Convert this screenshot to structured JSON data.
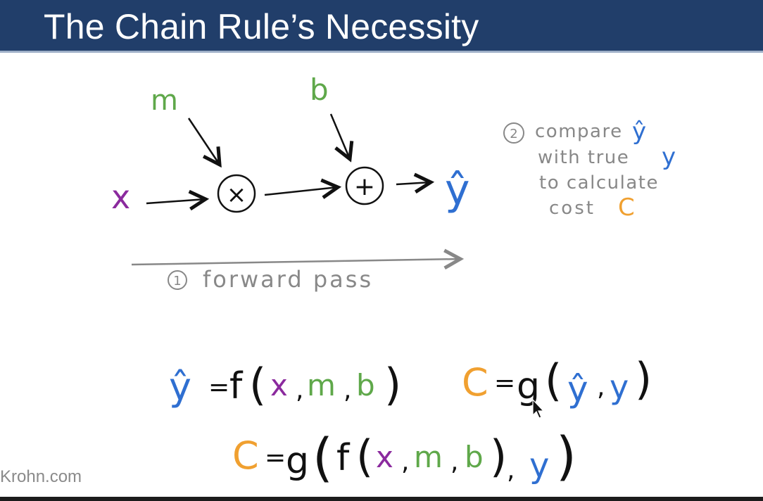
{
  "slide": {
    "title": "The Chain Rule’s Necessity",
    "watermark": "Krohn.com"
  },
  "graph": {
    "input_x": "x",
    "param_m": "m",
    "param_b": "b",
    "op_multiply": "×",
    "op_add": "+",
    "output_yhat": "ŷ"
  },
  "forward_pass": {
    "step_number": "1",
    "label": "forward pass"
  },
  "compare_note": {
    "step_number": "2",
    "line1_text": "compare",
    "line1_var": "ŷ",
    "line2_text": "with true",
    "line2_var": "y",
    "line3_text": "to calculate",
    "line4_text": "cost",
    "line4_var": "C"
  },
  "equations": {
    "eq1": {
      "lhs": "ŷ",
      "eq": "=",
      "fn": "f",
      "open": "(",
      "a1": "x",
      "s1": ",",
      "a2": "m",
      "s2": ",",
      "a3": "b",
      "close": ")"
    },
    "eq2": {
      "lhs": "C",
      "eq": "=",
      "fn": "g",
      "open": "(",
      "a1": "ŷ",
      "s1": ",",
      "a2": "y",
      "close": ")"
    },
    "eq3": {
      "lhs": "C",
      "eq": "=",
      "fn": "g",
      "open": "(",
      "inner_fn": "f",
      "inner_open": "(",
      "a1": "x",
      "s1": ",",
      "a2": "m",
      "s2": ",",
      "a3": "b",
      "inner_close": ")",
      "s3": ",",
      "a4": "y",
      "close": ")"
    }
  },
  "colors": {
    "title_bar": "#213e6a",
    "ink": "#111111",
    "purple_x": "#8b2a9e",
    "green_params": "#5fa84a",
    "blue_y": "#2f6fd1",
    "orange_cost": "#f0a030",
    "gray_notes": "#888888"
  },
  "cursor_icon": "mouse-pointer-icon"
}
